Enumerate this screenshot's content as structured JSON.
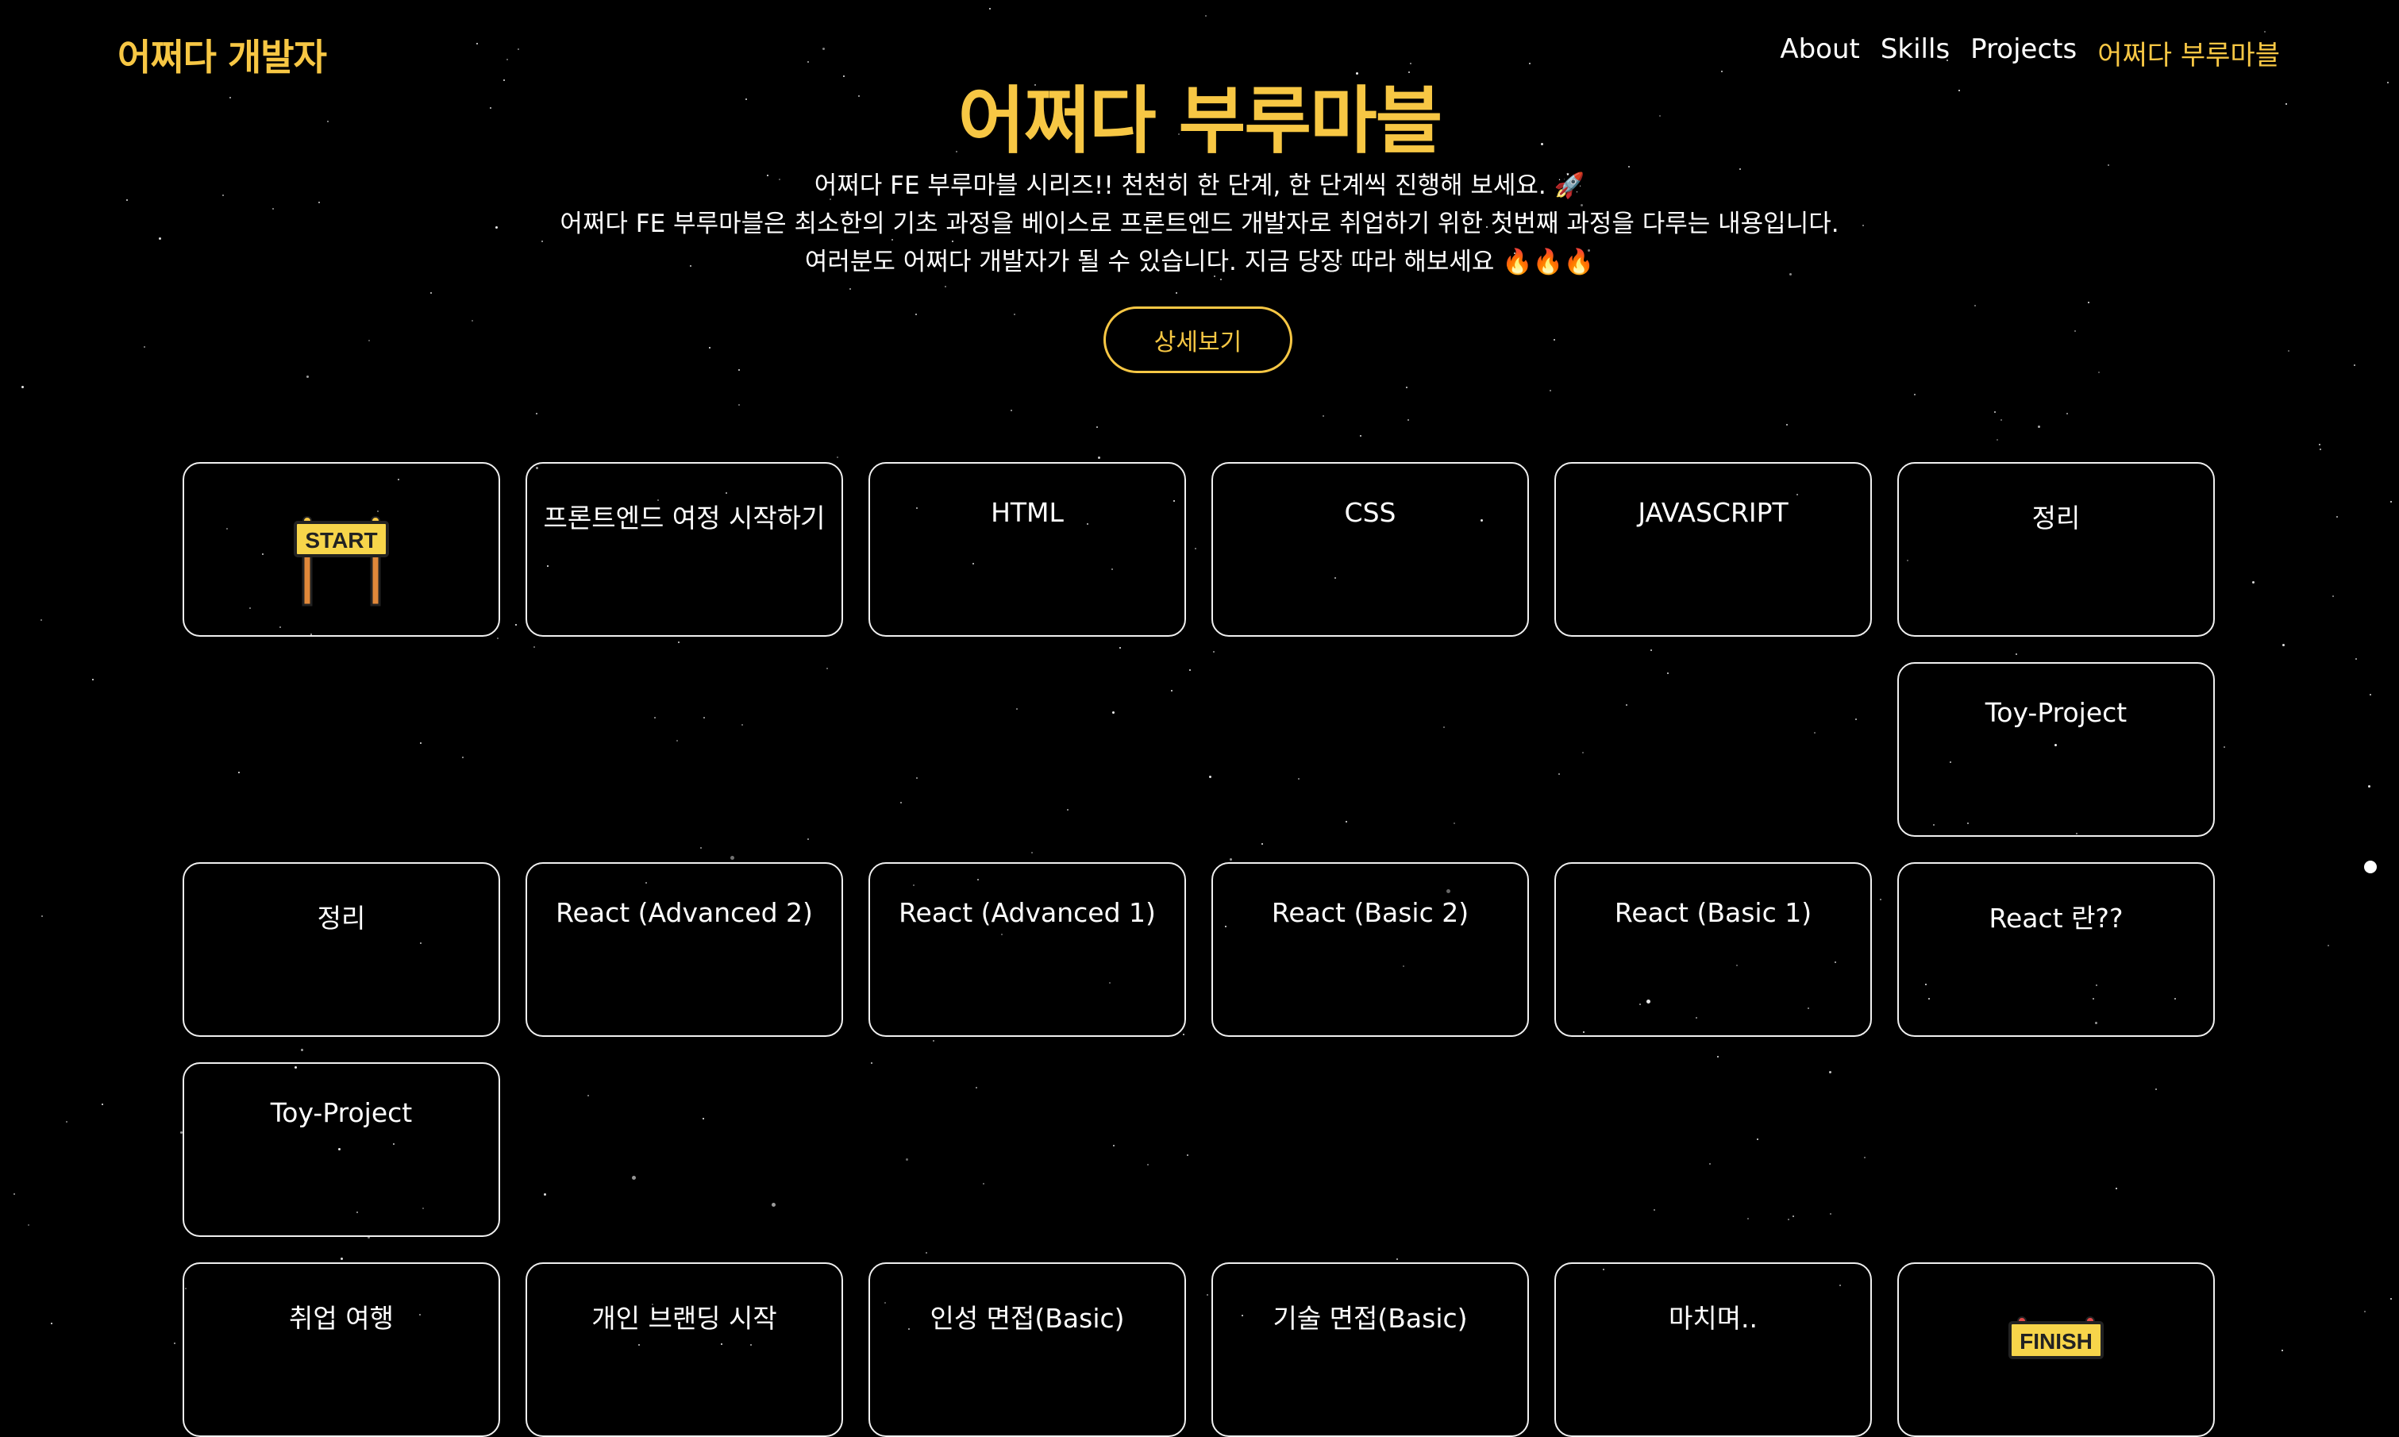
{
  "header": {
    "logo": "어쩌다 개발자",
    "nav": [
      "About",
      "Skills",
      "Projects",
      "어쩌다 부루마블"
    ],
    "active_nav": "어쩌다 부루마블"
  },
  "hero": {
    "title": "어쩌다 부루마블",
    "lines": [
      "어쩌다 FE 부루마블 시리즈!! 천천히 한 단계, 한 단계씩 진행해 보세요. 🚀",
      "어쩌다 FE 부루마블은 최소한의 기초 과정을 베이스로 프론트엔드 개발자로 취업하기 위한 첫번째 과정을 다루는 내용입니다.",
      "여러분도 어쩌다 개발자가 될 수 있습니다. 지금 당장 따라 해보세요 🔥🔥🔥"
    ],
    "button": "상세보기"
  },
  "board": {
    "row1": [
      "START",
      "프론트엔드 여정 시작하기",
      "HTML",
      "CSS",
      "JAVASCRIPT",
      "정리"
    ],
    "connector1": "Toy-Project",
    "row2": [
      "정리",
      "React (Advanced 2)",
      "React (Advanced 1)",
      "React (Basic 2)",
      "React (Basic 1)",
      "React 란??"
    ],
    "connector2": "Toy-Project",
    "row3": [
      "취업 여행",
      "개인 브랜딩 시작",
      "인성 면접(Basic)",
      "기술 면접(Basic)",
      "마치며..",
      "FINISH"
    ]
  },
  "colors": {
    "accent": "#f7c744",
    "background": "#000000",
    "tile_border": "#f0f0f0"
  }
}
